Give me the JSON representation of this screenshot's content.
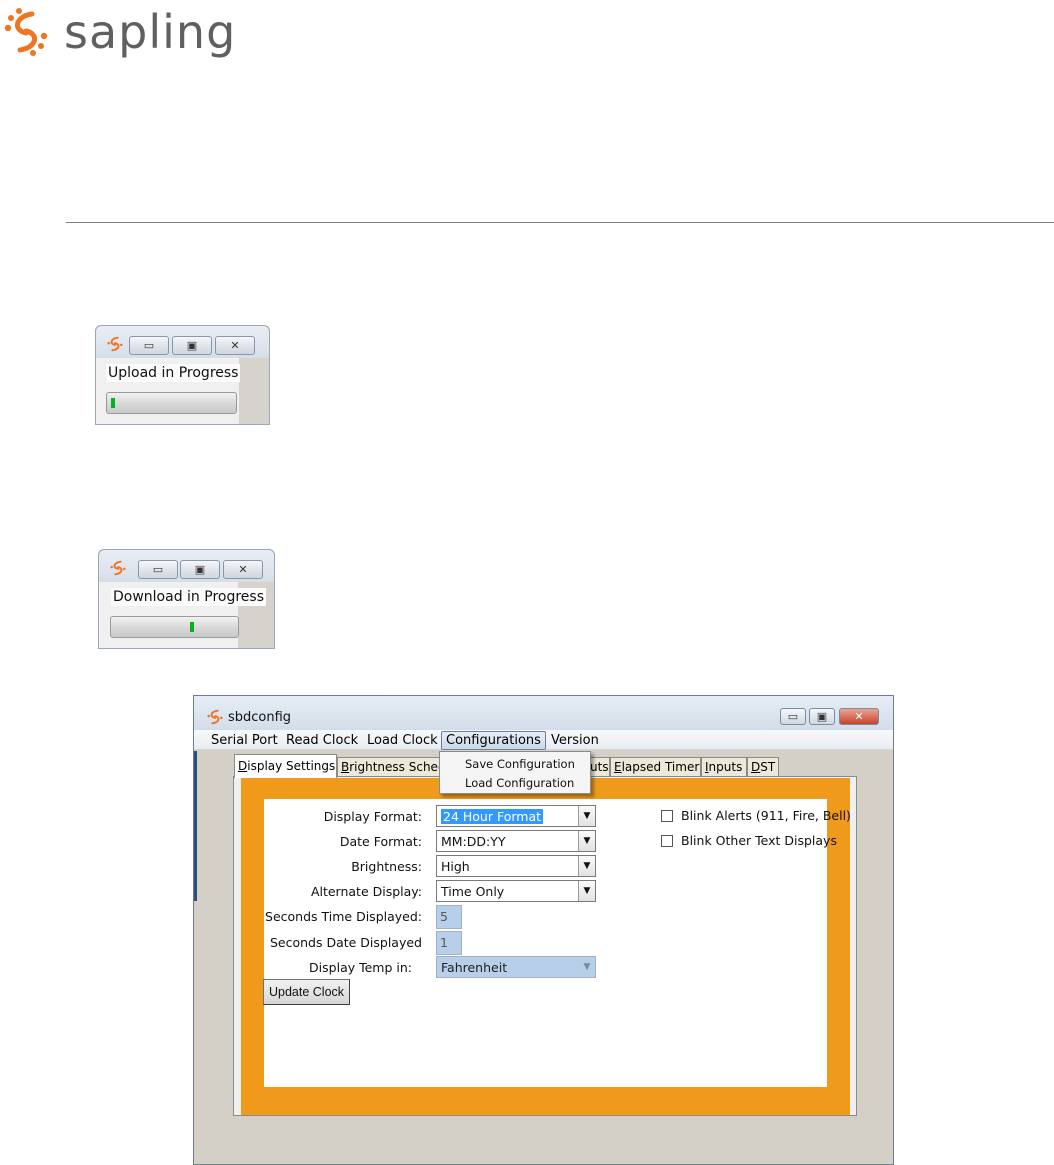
{
  "brand": {
    "name": "sapling",
    "color": "#ee7623",
    "text_color": "#5f6062"
  },
  "upload_window": {
    "label": "Upload in Progress",
    "progress_fraction": 0.02,
    "buttons": [
      "minimize-icon",
      "maximize-icon",
      "close-icon"
    ]
  },
  "download_window": {
    "label": "Download in Progress",
    "progress_fraction": 0.65,
    "buttons": [
      "minimize-icon",
      "maximize-icon",
      "close-icon"
    ]
  },
  "sbdconfig": {
    "title": "sbdconfig",
    "menus": [
      "Serial Port",
      "Read Clock",
      "Load Clock",
      "Configurations",
      "Version"
    ],
    "open_menu": "Configurations",
    "dropdown_items": [
      "Save Configuration",
      "Load Configuration"
    ],
    "tabs": [
      {
        "accel": "D",
        "rest": "isplay Settings",
        "active": true
      },
      {
        "accel": "B",
        "rest": "rightness Sched",
        "active": false
      },
      {
        "accel": "",
        "rest": "uts",
        "active": false
      },
      {
        "accel": "E",
        "rest": "lapsed Timer",
        "active": false
      },
      {
        "accel": "I",
        "rest": "nputs",
        "active": false
      },
      {
        "accel": "D",
        "rest": "ST",
        "active": false
      }
    ],
    "panel_accent": "#ef9a1b",
    "fields": {
      "display_format": {
        "label": "Display Format:",
        "value": "24 Hour Format"
      },
      "date_format": {
        "label": "Date Format:",
        "value": "MM:DD:YY"
      },
      "brightness": {
        "label": "Brightness:",
        "value": "High"
      },
      "alternate_display": {
        "label": "Alternate Display:",
        "value": "Time Only"
      },
      "seconds_time": {
        "label": "Seconds Time Displayed:",
        "value": "5"
      },
      "seconds_date": {
        "label": "Seconds Date Displayed",
        "value": "1"
      },
      "display_temp": {
        "label": "Display Temp in:",
        "value": "Fahrenheit"
      }
    },
    "checkboxes": [
      {
        "label": "Blink Alerts (911, Fire, Bell)",
        "checked": false
      },
      {
        "label": "Blink Other Text Displays",
        "checked": false
      }
    ],
    "update_button": "Update Clock",
    "combo_arrow_glyph": "▼"
  }
}
